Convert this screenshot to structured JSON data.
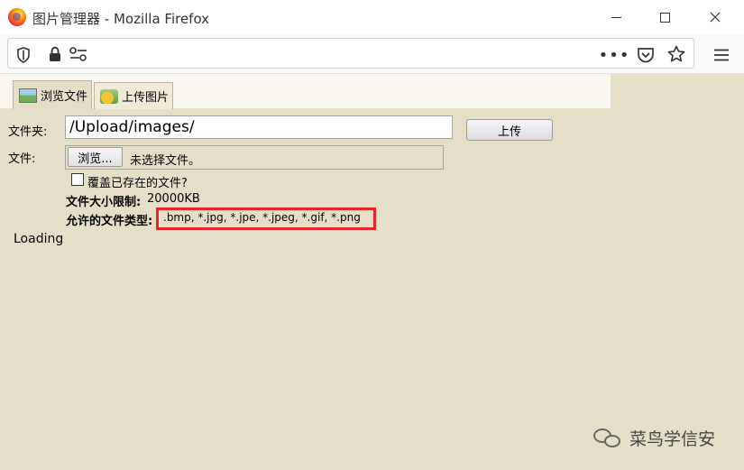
{
  "window": {
    "title": "图片管理器 - Mozilla Firefox"
  },
  "tabs": [
    {
      "label": "浏览文件",
      "icon": "image-browse-icon",
      "active": true
    },
    {
      "label": "上传图片",
      "icon": "image-upload-icon",
      "active": false
    }
  ],
  "form": {
    "folder_label": "文件夹:",
    "folder_value": "/Upload/images/",
    "upload_button": "上传",
    "file_label": "文件:",
    "browse_button": "浏览...",
    "no_file_text": "未选择文件。",
    "overwrite_label": "覆盖已存在的文件?",
    "max_size_label": "文件大小限制:",
    "max_size_value": "20000KB",
    "allowed_types_label": "允许的文件类型:",
    "allowed_types_value": ".bmp, *.jpg, *.jpe, *.jpeg, *.gif, *.png"
  },
  "status": {
    "loading": "Loading"
  },
  "watermark": {
    "text": "菜鸟学信安"
  },
  "colors": {
    "background": "#e6dfc8",
    "highlight": "#e8232a"
  }
}
